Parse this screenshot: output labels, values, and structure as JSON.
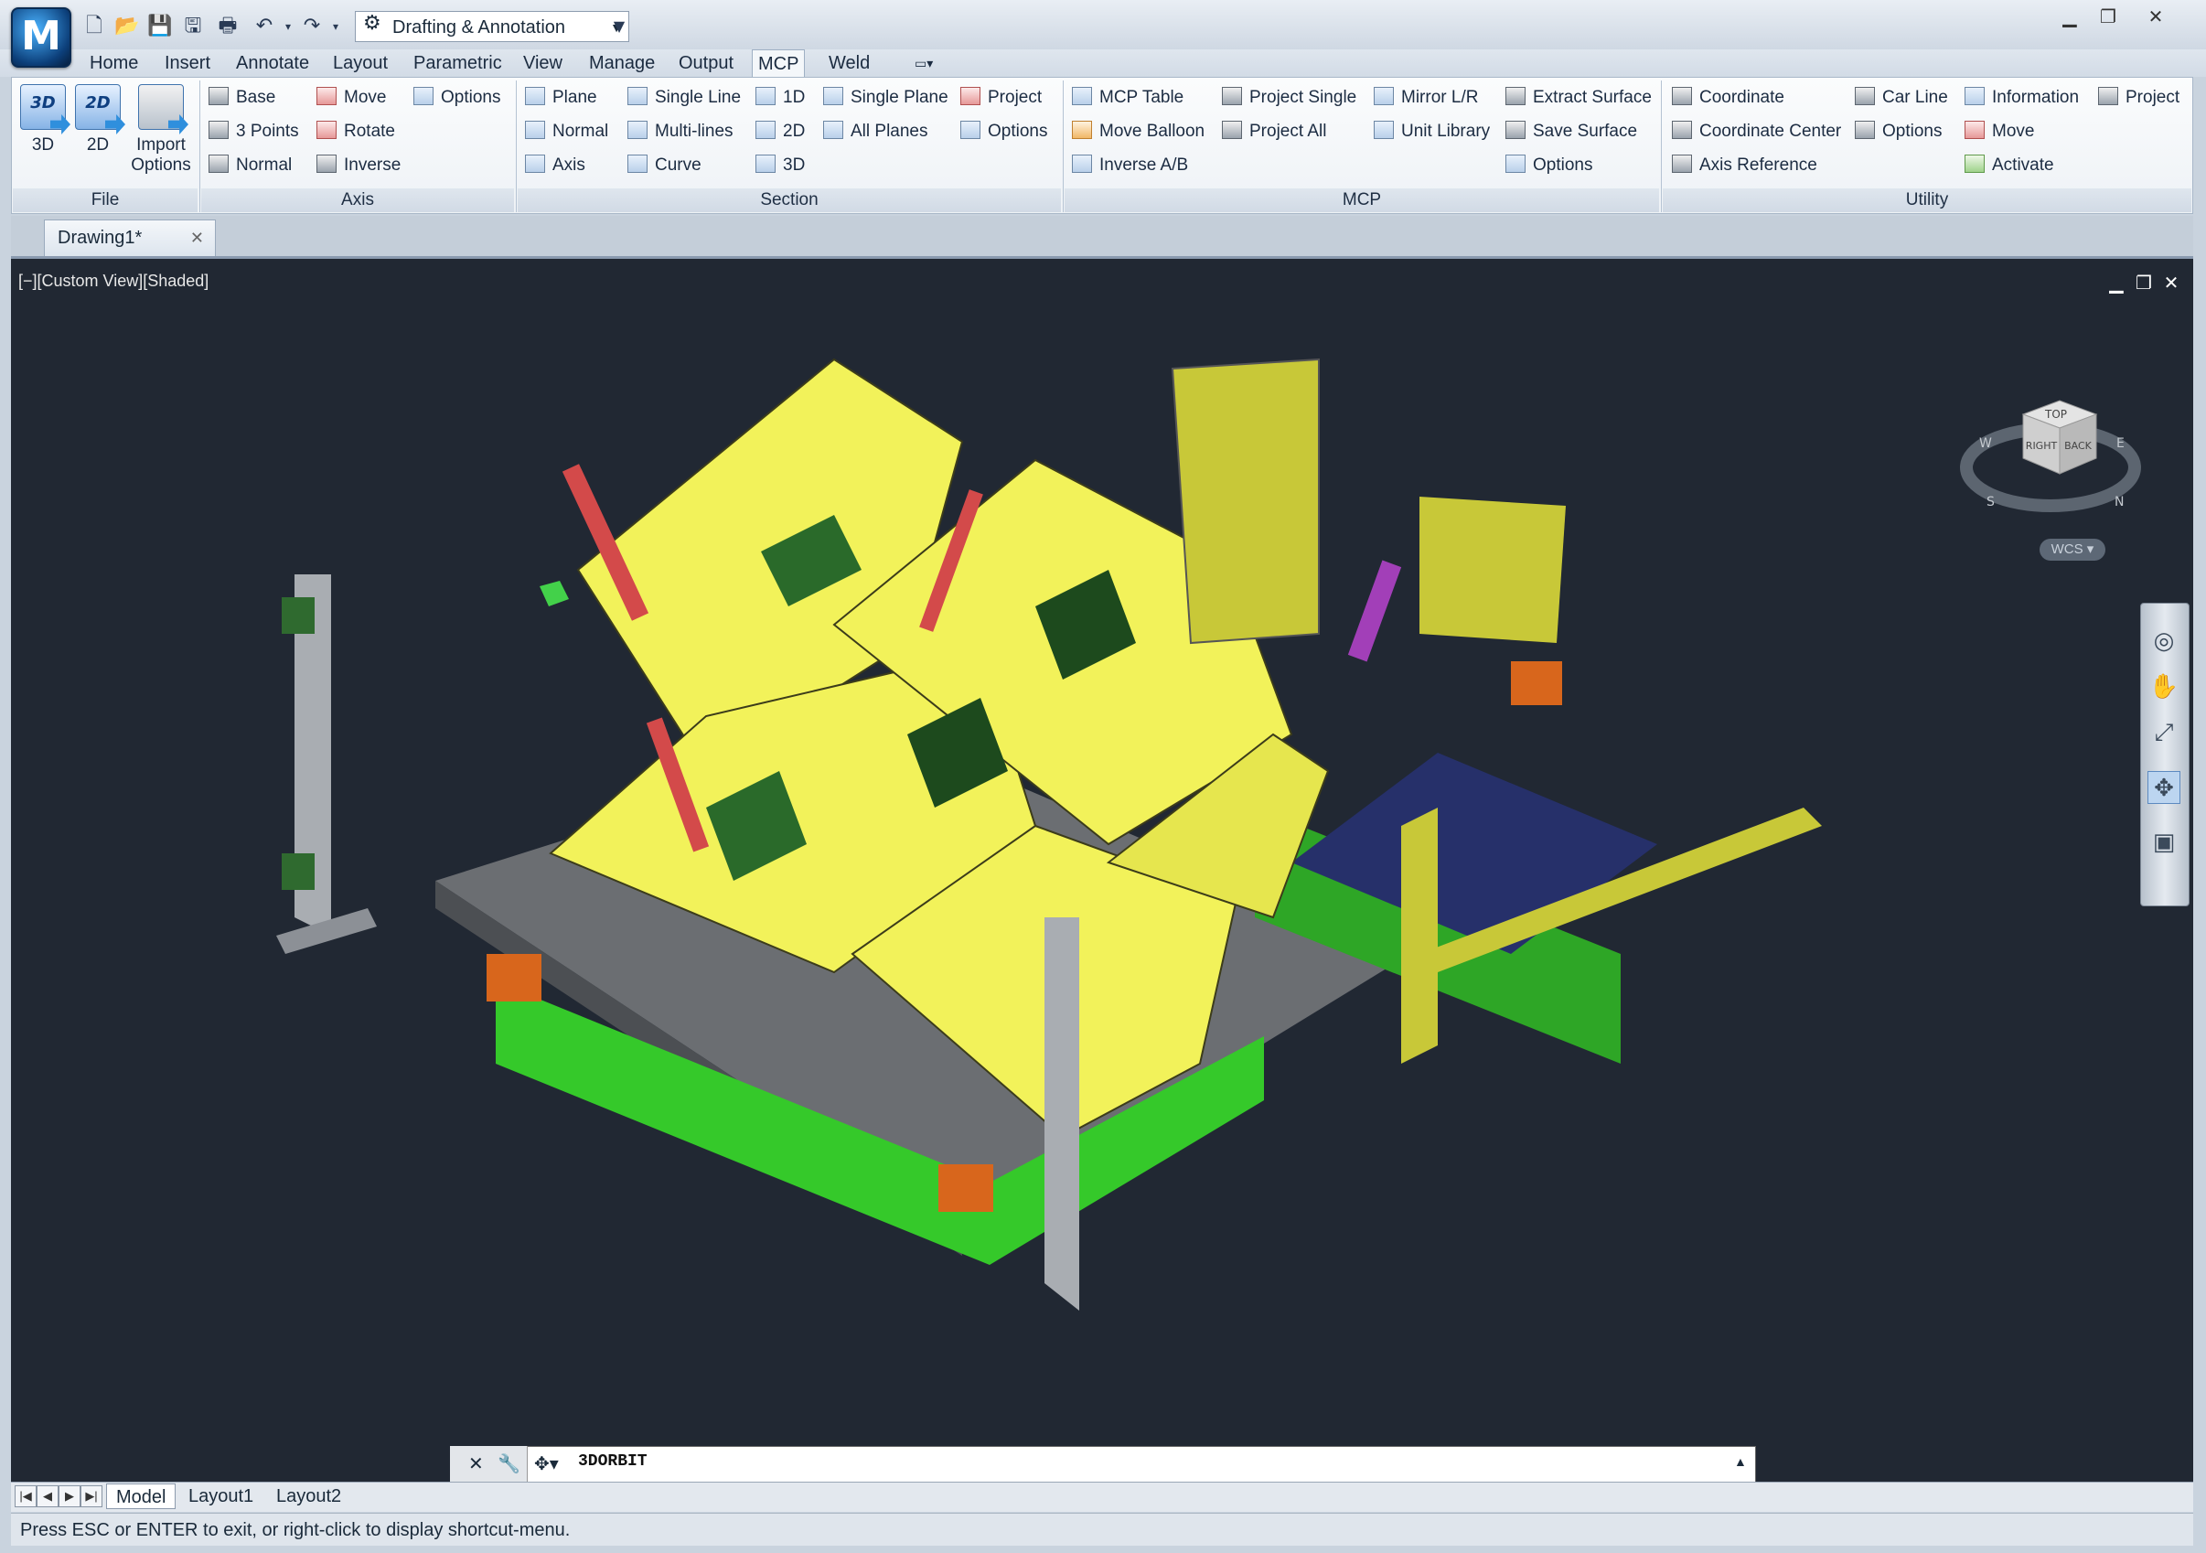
{
  "window": {
    "workspace": "Drafting & Annotation"
  },
  "ribbon_tabs": [
    "Home",
    "Insert",
    "Annotate",
    "Layout",
    "Parametric",
    "View",
    "Manage",
    "Output",
    "MCP",
    "Weld"
  ],
  "active_tab": "MCP",
  "file_group": {
    "label": "File",
    "btn_3d": "3D",
    "btn_2d": "2D",
    "btn_import": "Import Options",
    "icon_3d": "3D",
    "icon_2d": "2D"
  },
  "axis_group": {
    "label": "Axis",
    "base": "Base",
    "three_points": "3 Points",
    "normal": "Normal",
    "move": "Move",
    "rotate": "Rotate",
    "inverse": "Inverse",
    "options": "Options"
  },
  "section_group": {
    "label": "Section",
    "plane": "Plane",
    "normal": "Normal",
    "axis": "Axis",
    "single_line": "Single Line",
    "multi_lines": "Multi-lines",
    "curve": "Curve",
    "d1": "1D",
    "d2": "2D",
    "d3": "3D",
    "single_plane": "Single Plane",
    "all_planes": "All Planes",
    "project": "Project",
    "options": "Options"
  },
  "mcp_group": {
    "label": "MCP",
    "mcp_table": "MCP Table",
    "move_balloon": "Move Balloon",
    "inverse_ab": "Inverse A/B",
    "project_single": "Project Single",
    "project_all": "Project All",
    "mirror_lr": "Mirror L/R",
    "unit_library": "Unit Library",
    "extract_surface": "Extract Surface",
    "save_surface": "Save Surface",
    "options": "Options"
  },
  "utility_group": {
    "label": "Utility",
    "coordinate": "Coordinate",
    "coordinate_center": "Coordinate Center",
    "axis_reference": "Axis Reference",
    "car_line": "Car Line",
    "options": "Options",
    "information": "Information",
    "move": "Move",
    "activate": "Activate",
    "project": "Project"
  },
  "document_tab": "Drawing1*",
  "viewport": {
    "label": "[−][Custom View][Shaded]"
  },
  "viewcube": {
    "top": "TOP",
    "right": "RIGHT",
    "back": "BACK",
    "compass_w": "W",
    "compass_s": "S",
    "compass_n": "N",
    "compass_e": "E",
    "wcs": "WCS"
  },
  "command_line": {
    "text": "3DORBIT"
  },
  "layout_tabs": [
    "Model",
    "Layout1",
    "Layout2"
  ],
  "status_message": "Press ESC or ENTER to exit, or right-click to display shortcut-menu.",
  "colors": {
    "viewport_bg": "#212833",
    "fixture_yellow": "#f2f25a",
    "base_green": "#35c92a",
    "accent_orange": "#d8661c"
  }
}
